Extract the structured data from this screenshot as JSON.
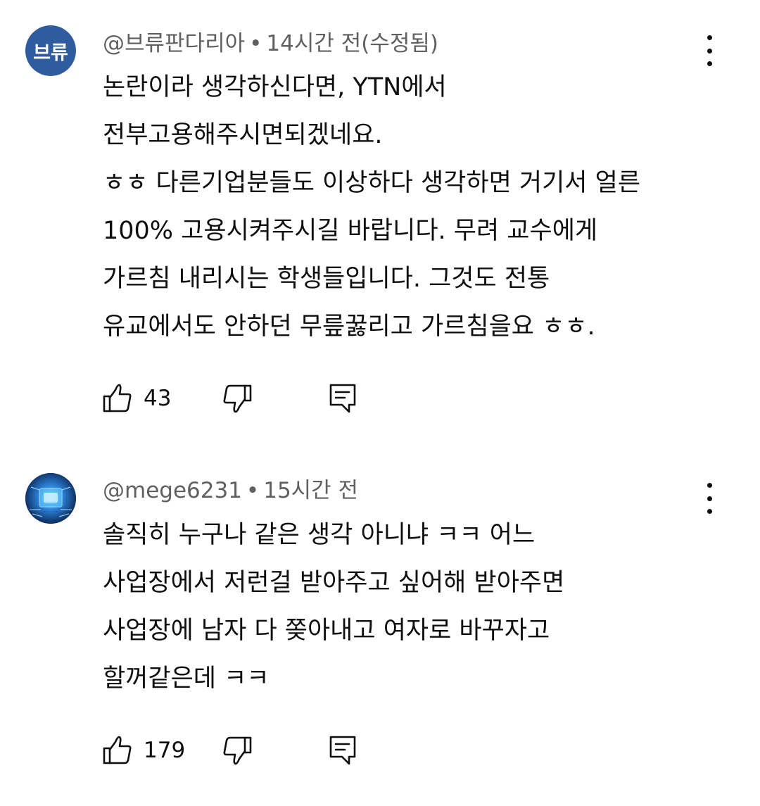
{
  "comments": [
    {
      "avatar_text": "브류",
      "avatar_color": "#2f5c9e",
      "handle": "@브류판다리아",
      "time": "14시간 전(수정됨)",
      "separator": "•",
      "lines": [
        "논란이라 생각하신다면, YTN에서",
        "전부고용해주시면되겠네요.",
        "ㅎㅎ 다른기업분들도 이상하다 생각하면 거기서 얼른",
        "100% 고용시켜주시길 바랍니다.  무려 교수에게",
        "가르침 내리시는 학생들입니다. 그것도 전통",
        "유교에서도 안하던 무릎꿇리고 가르침을요 ㅎㅎ."
      ],
      "likes": "43",
      "icons": {
        "like": "thumbs-up-icon",
        "dislike": "thumbs-down-icon",
        "reply": "reply-comment-icon",
        "more": "more-vertical-icon"
      }
    },
    {
      "avatar_text": "",
      "avatar_color": "#1a3d7a",
      "handle": "@mege6231",
      "time": "15시간 전",
      "separator": "•",
      "lines": [
        "솔직히 누구나 같은 생각 아니냐 ㅋㅋ 어느",
        "사업장에서 저런걸 받아주고 싶어해 받아주면",
        "사업장에 남자 다 쫒아내고 여자로 바꾸자고",
        "할꺼같은데 ㅋㅋ"
      ],
      "likes": "179",
      "icons": {
        "like": "thumbs-up-icon",
        "dislike": "thumbs-down-icon",
        "reply": "reply-comment-icon",
        "more": "more-vertical-icon"
      }
    }
  ]
}
